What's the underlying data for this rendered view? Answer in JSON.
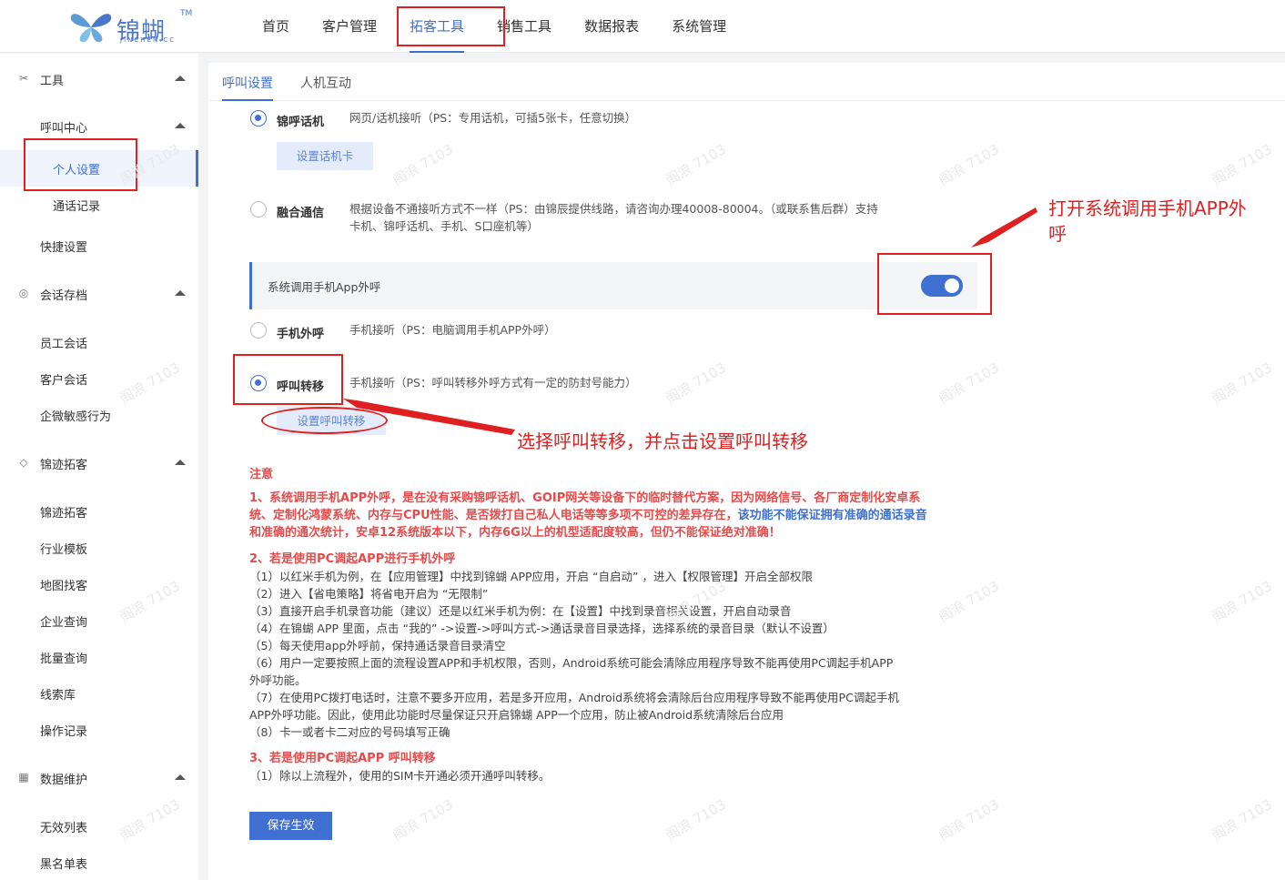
{
  "logo": {
    "name": "锦蝴",
    "tm": "TM",
    "sub": "JINCHEN.CC"
  },
  "nav": [
    "首页",
    "客户管理",
    "拓客工具",
    "销售工具",
    "数据报表",
    "系统管理"
  ],
  "sidebar": {
    "groups": [
      {
        "label": "工具",
        "icon": "tools-icon",
        "items": []
      },
      {
        "label": "呼叫中心",
        "items": [
          "个人设置",
          "通话记录"
        ]
      },
      {
        "label": "快捷设置"
      },
      {
        "label": "会话存档",
        "icon": "chat-icon",
        "items": [
          "员工会话",
          "客户会话",
          "企微敏感行为"
        ]
      },
      {
        "label": "锦迹拓客",
        "icon": "diamond-icon",
        "items": [
          "锦迹拓客",
          "行业模板",
          "地图找客",
          "企业查询",
          "批量查询",
          "线索库",
          "操作记录"
        ]
      },
      {
        "label": "数据维护",
        "icon": "calendar-icon",
        "items": [
          "无效列表",
          "黑名单表"
        ]
      }
    ]
  },
  "tabs": [
    "呼叫设置",
    "人机互动"
  ],
  "options": {
    "jinhu": {
      "title": "锦呼话机",
      "desc": "网页/话机接听（PS：专用话机，可插5张卡，任意切换）",
      "button": "设置话机卡"
    },
    "fusion": {
      "title": "融合通信",
      "desc1": "根据设备不通接听方式不一样（PS：由锦辰提供线路，请咨询办理40008-80004。（或联系售后群）支持",
      "desc2": "卡机、锦呼话机、手机、S口座机等）"
    },
    "toggle_label": "系统调用手机App外呼",
    "mobile": {
      "title": "手机外呼",
      "desc": "手机接听（PS：电脑调用手机APP外呼）"
    },
    "transfer": {
      "title": "呼叫转移",
      "desc": "手机接听（PS：呼叫转移外呼方式有一定的防封号能力）",
      "button": "设置呼叫转移"
    }
  },
  "notes": {
    "title": "注意",
    "p1a": "1、系统调用手机APP外呼，是在没有采购锦呼话机、GOIP网关等设备下的临时替代方案，因为网络信号、各厂商定制化安卓系",
    "p1b": "统、定制化鸿蒙系统、内存与CPU性能、是否拨打自己私人电话等等多项不可控的差异存在，",
    "p1b_blue": "该功能不能保证拥有准确的通话录音",
    "p1c": "和准确的通次统计，安卓12系统版本以下，内存6G以上的机型适配度较高，但仍不能保证绝对准确！",
    "h2": "2、若是使用PC调起APP进行手机外呼",
    "l1": "（1）以红米手机为例，在【应用管理】中找到锦蝴 APP应用，开启 “自启动” ，进入【权限管理】开启全部权限",
    "l2": "（2）进入【省电策略】将省电开启为 “无限制”",
    "l3": "（3）直接开启手机录音功能（建议）还是以红米手机为例：在【设置】中找到录音相关设置，开启自动录音",
    "l4": "（4）在锦蝴 APP 里面，点击 “我的” ->设置->呼叫方式->通话录音目录选择，选择系统的录音目录（默认不设置）",
    "l5": "（5）每天使用app外呼前，保持通话录音目录清空",
    "l6a": "（6）用户一定要按照上面的流程设置APP和手机权限，否则，Android系统可能会清除应用程序导致不能再使用PC调起手机APP",
    "l6b": "外呼功能。",
    "l7a": "（7）在使用PC拨打电话时，注意不要多开应用，若是多开应用，Android系统将会清除后台应用程序导致不能再使用PC调起手机",
    "l7b": "APP外呼功能。因此，使用此功能时尽量保证只开启锦蝴 APP一个应用，防止被Android系统清除后台应用",
    "l8": "（8）卡一或者卡二对应的号码填写正确",
    "h3": "3、若是使用PC调起APP 呼叫转移",
    "m1": "（1）除以上流程外，使用的SIM卡开通必须开通呼叫转移。"
  },
  "save_button": "保存生效",
  "annotations": {
    "toggle_hint_1": "打开系统调用手机APP外",
    "toggle_hint_2": "呼",
    "transfer_hint": "选择呼叫转移，并点击设置呼叫转移"
  },
  "watermark": "阁浪 7103",
  "colors": {
    "accent": "#3f6fd1",
    "annotation": "#e02020",
    "note_red": "#e84a4a"
  }
}
